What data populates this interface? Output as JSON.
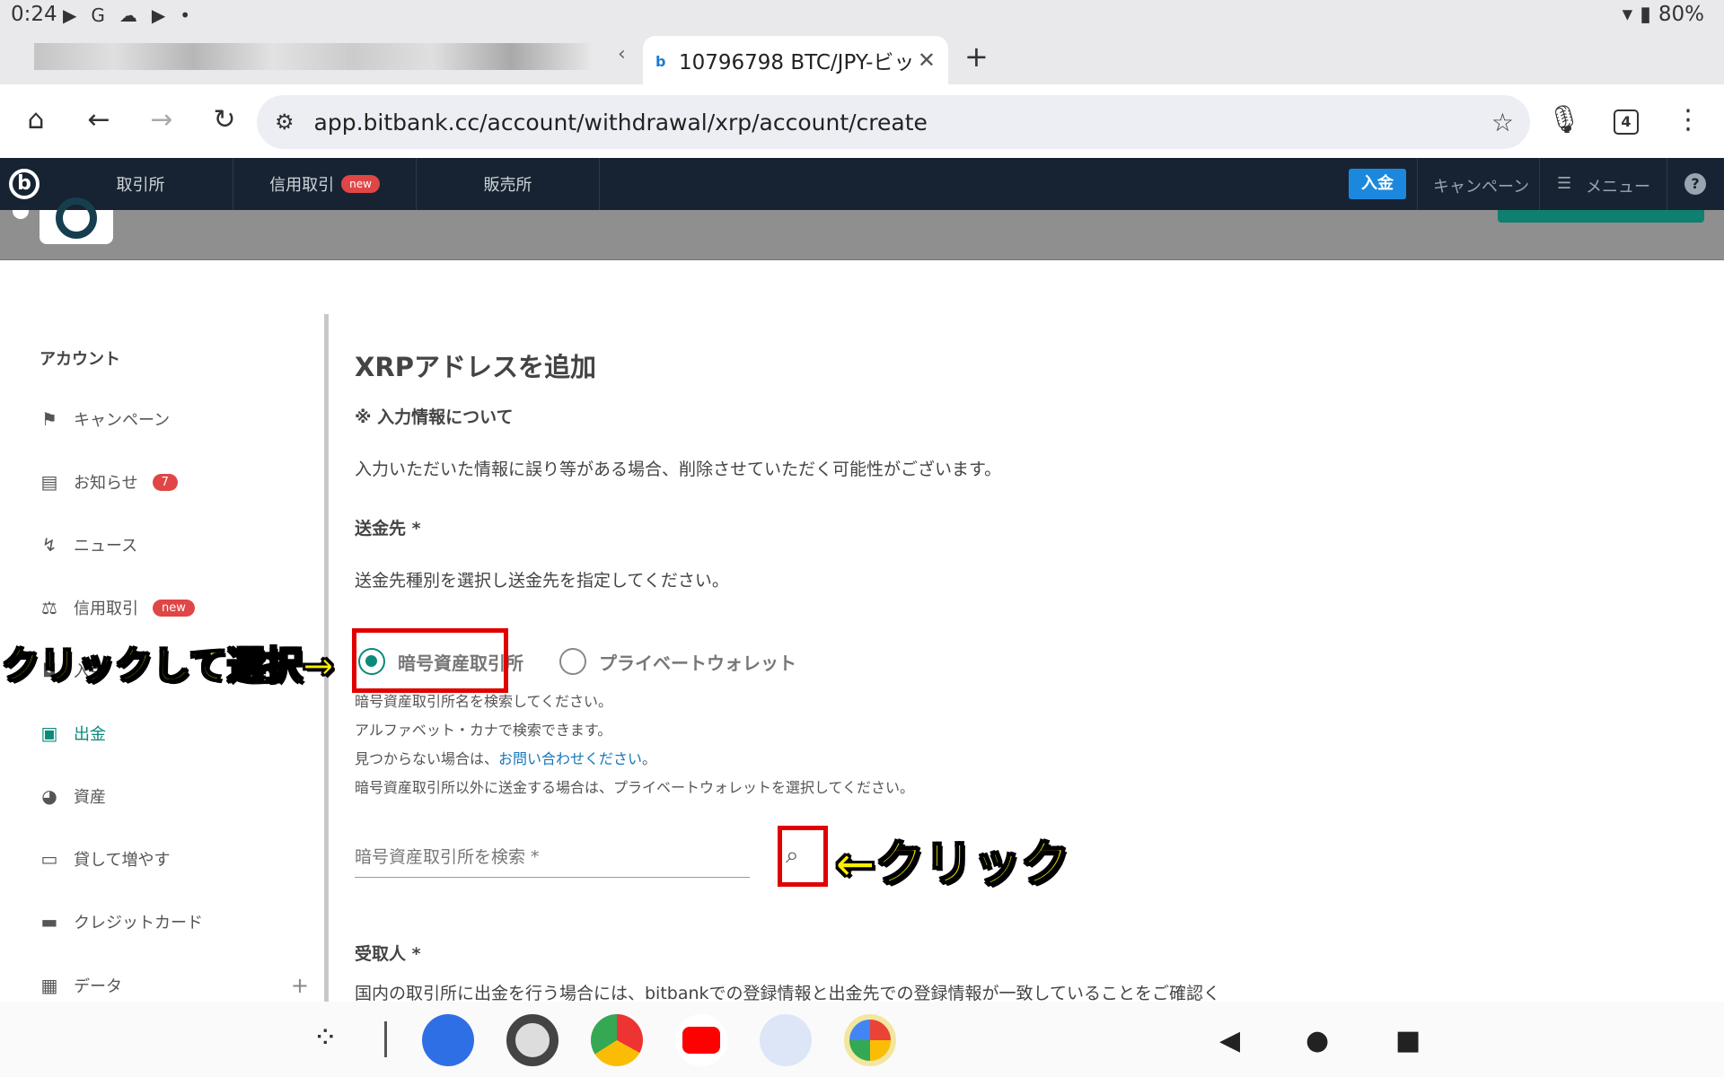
{
  "status": {
    "time": "0:24",
    "battery": "80%"
  },
  "browser": {
    "active_tab_title": "10796798 BTC/JPY-ビッ",
    "active_tab_favicon": "b",
    "url": "app.bitbank.cc/account/withdrawal/xrp/account/create",
    "tab_count": "4"
  },
  "sitenav": {
    "items": [
      "取引所",
      "信用取引",
      "販売所"
    ],
    "new_badge": "new",
    "deposit": "入金",
    "campaign": "キャンペーン",
    "menu": "メニュー",
    "help": "?"
  },
  "sidebar": {
    "heading": "アカウント",
    "items": [
      {
        "label": "キャンペーン"
      },
      {
        "label": "お知らせ",
        "badge": "7"
      },
      {
        "label": "ニュース"
      },
      {
        "label": "信用取引",
        "badge": "new"
      },
      {
        "label": "入金"
      },
      {
        "label": "出金"
      },
      {
        "label": "資産"
      },
      {
        "label": "貸して増やす"
      },
      {
        "label": "クレジットカード"
      },
      {
        "label": "データ"
      }
    ]
  },
  "main": {
    "title": "XRPアドレスを追加",
    "notice_heading": "※ 入力情報について",
    "notice_text": "入力いただいた情報に誤り等がある場合、削除させていただく可能性がございます。",
    "dest_heading": "送金先 *",
    "dest_text": "送金先種別を選択し送金先を指定してください。",
    "radio_exchange": "暗号資産取引所",
    "radio_wallet": "プライベートウォレット",
    "help1": "暗号資産取引所名を検索してください。",
    "help2": "アルファベット・カナで検索できます。",
    "help3_prefix": "見つからない場合は、",
    "help3_link": "お問い合わせください",
    "help3_suffix": "。",
    "help4": "暗号資産取引所以外に送金する場合は、プライベートウォレットを選択してください。",
    "search_placeholder": "暗号資産取引所を検索 *",
    "recipient_heading": "受取人 *",
    "recipient_text": "国内の取引所に出金を行う場合には、bitbankでの登録情報と出金先での登録情報が一致していることをご確認く"
  },
  "annotations": {
    "select": "クリックして選択→",
    "click": "←クリック"
  },
  "colors": {
    "accent": "#0b8a7a",
    "nav_bg": "#172332",
    "annotation": "#ffef00",
    "highlight_box": "#e10000"
  }
}
